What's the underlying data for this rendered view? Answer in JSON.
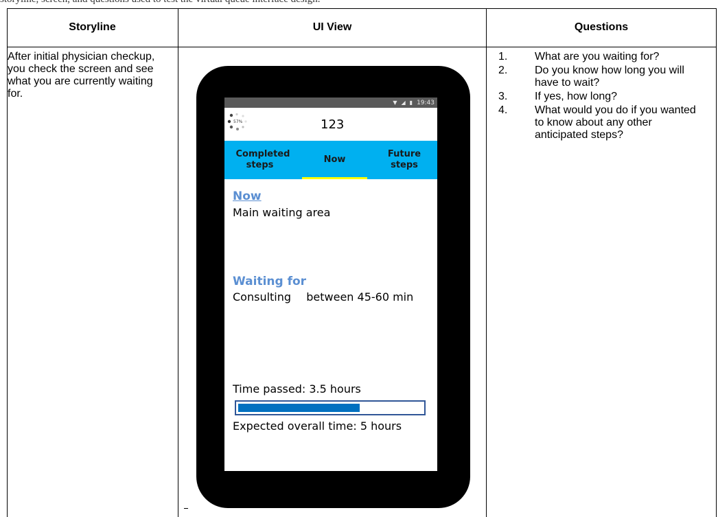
{
  "caption": "storyline, screen, and questions used to test the virtual queue interface design.",
  "table": {
    "headers": {
      "storyline": "Storyline",
      "ui_view": "UI View",
      "questions": "Questions"
    },
    "storyline": "After initial physician checkup, you check the screen and see what you are currently waiting for.",
    "questions": [
      {
        "num": "1.",
        "text": "What are you waiting for?"
      },
      {
        "num": "2.",
        "text": "Do you know how long you will have to wait?"
      },
      {
        "num": "3.",
        "text": "If yes, how long?"
      },
      {
        "num": "4.",
        "text": "What would you do if you wanted to know about any other anticipated steps?"
      }
    ]
  },
  "phone": {
    "status_time": "19:43",
    "spinner_text": "57%",
    "app_title": "123",
    "tabs": [
      {
        "label": "Completed steps",
        "active": false
      },
      {
        "label": "Now",
        "active": true
      },
      {
        "label": "Future steps",
        "active": false
      }
    ],
    "now_heading": "Now",
    "now_location": "Main waiting area",
    "waiting_heading": "Waiting for",
    "waiting_item": "Consulting",
    "waiting_time": "between 45-60 min",
    "time_passed": "Time passed: 3.5 hours",
    "progress_fraction": 0.66,
    "expected_time": "Expected overall time: 5 hours"
  },
  "colors": {
    "tab_bar": "#00b0f0",
    "tab_underline": "#ffff00",
    "heading_blue": "#5b8fd2",
    "progress_fill": "#0070c0"
  }
}
